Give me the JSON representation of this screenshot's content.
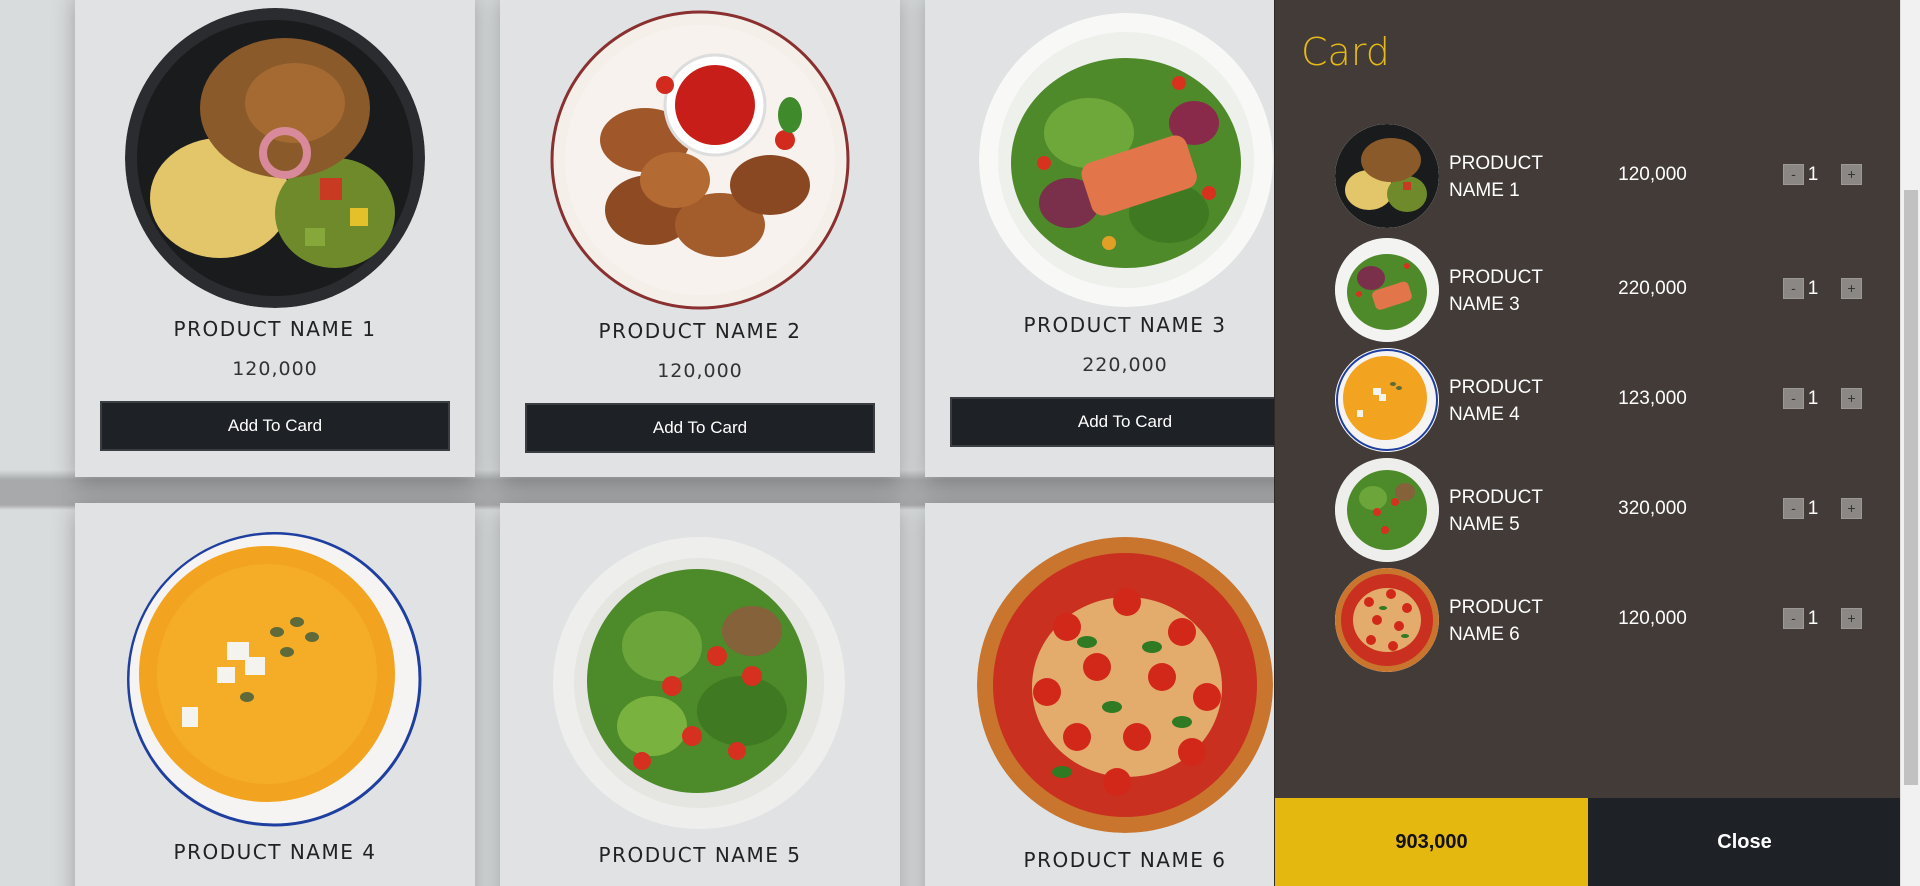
{
  "products": [
    {
      "name": "PRODUCT NAME 1",
      "price": "120,000",
      "button": "Add To Card"
    },
    {
      "name": "PRODUCT NAME 2",
      "price": "120,000",
      "button": "Add To Card"
    },
    {
      "name": "PRODUCT NAME 3",
      "price": "220,000",
      "button": "Add To Card"
    },
    {
      "name": "PRODUCT NAME 4"
    },
    {
      "name": "PRODUCT NAME 5"
    },
    {
      "name": "PRODUCT NAME 6"
    }
  ],
  "cart": {
    "title": "Card",
    "items": [
      {
        "name": "PRODUCT NAME 1",
        "price": "120,000",
        "qty": "1",
        "minus": "-",
        "plus": "+"
      },
      {
        "name": "PRODUCT NAME 3",
        "price": "220,000",
        "qty": "1",
        "minus": "-",
        "plus": "+"
      },
      {
        "name": "PRODUCT NAME 4",
        "price": "123,000",
        "qty": "1",
        "minus": "-",
        "plus": "+"
      },
      {
        "name": "PRODUCT NAME 5",
        "price": "320,000",
        "qty": "1",
        "minus": "-",
        "plus": "+"
      },
      {
        "name": "PRODUCT NAME 6",
        "price": "120,000",
        "qty": "1",
        "minus": "-",
        "plus": "+"
      }
    ],
    "total": "903,000",
    "close_label": "Close"
  },
  "icons": [
    "bowl-dish-image",
    "chicken-wings-image",
    "salmon-salad-image",
    "pumpkin-soup-image",
    "green-salad-image",
    "pizza-image"
  ],
  "colors": {
    "accent": "#e5b80f",
    "dark": "#1e2125",
    "panel": "#423b38"
  }
}
